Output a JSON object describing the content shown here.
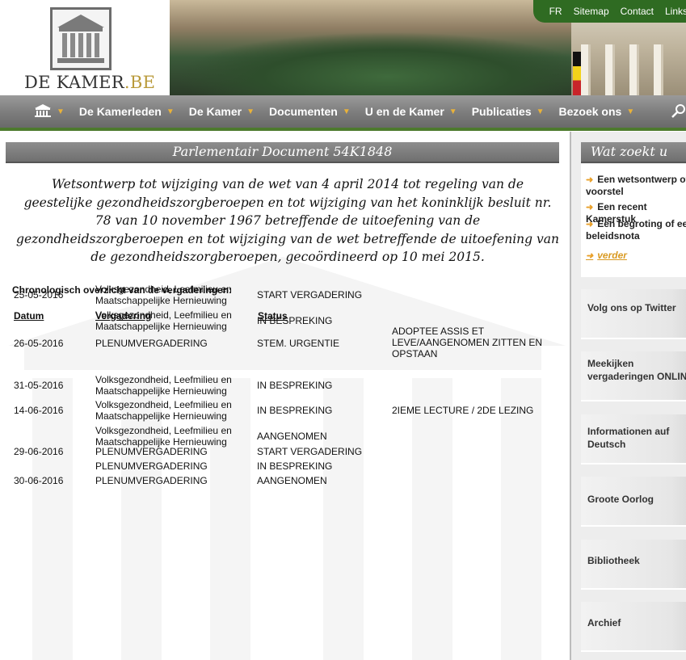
{
  "site": {
    "logo_text": "DE KAMER",
    "logo_suffix": ".BE"
  },
  "top_links": [
    "FR",
    "Sitemap",
    "Contact",
    "Links"
  ],
  "nav": {
    "items": [
      "De Kamerleden",
      "De Kamer",
      "Documenten",
      "U en de Kamer",
      "Publicaties",
      "Bezoek ons"
    ]
  },
  "document": {
    "title": "Parlementair Document 54K1848",
    "subject": "Wetsontwerp tot wijziging van de wet van 4 april 2014 tot regeling van de geestelijke gezondheidszorgberoepen en tot wijziging van het koninklijk besluit nr. 78 van 10 november 1967 betreffende de uitoefening van de gezondheidszorgberoepen en tot wijziging van de wet betreffende de uitoefening van de gezondheidszorgberoepen, gecoördineerd op 10 mei 2015.",
    "overview_heading": "Chronologisch overzicht van de vergaderingen:"
  },
  "meetings": {
    "headers": {
      "date": "Datum",
      "meeting": "Vergadering",
      "status": "Status"
    },
    "rows": [
      {
        "date": "25-05-2016",
        "meeting": "Volksgezondheid, Leefmilieu en Maatschappelijke Hernieuwing",
        "status": "START VERGADERING",
        "note": ""
      },
      {
        "date": "",
        "meeting": "Volksgezondheid, Leefmilieu en Maatschappelijke Hernieuwing",
        "status": "IN BESPREKING",
        "note": ""
      },
      {
        "date": "26-05-2016",
        "meeting": "PLENUMVERGADERING",
        "status": "STEM. URGENTIE",
        "note": "ADOPTEE ASSIS ET LEVE/AANGENOMEN ZITTEN EN OPSTAAN"
      },
      {
        "date": "31-05-2016",
        "meeting": "Volksgezondheid, Leefmilieu en Maatschappelijke Hernieuwing",
        "status": "IN BESPREKING",
        "note": ""
      },
      {
        "date": "14-06-2016",
        "meeting": "Volksgezondheid, Leefmilieu en Maatschappelijke Hernieuwing",
        "status": "IN BESPREKING",
        "note": "2IEME LECTURE / 2DE LEZING"
      },
      {
        "date": "",
        "meeting": "Volksgezondheid, Leefmilieu en Maatschappelijke Hernieuwing",
        "status": "AANGENOMEN",
        "note": ""
      },
      {
        "date": "29-06-2016",
        "meeting": "PLENUMVERGADERING",
        "status": "START VERGADERING",
        "note": ""
      },
      {
        "date": "",
        "meeting": "PLENUMVERGADERING",
        "status": "IN BESPREKING",
        "note": ""
      },
      {
        "date": "30-06-2016",
        "meeting": "PLENUMVERGADERING",
        "status": "AANGENOMEN",
        "note": ""
      }
    ]
  },
  "sidebar": {
    "search_title": "Wat zoekt u",
    "search_links": [
      "Een wetsontwerp of voorstel",
      "Een recent Kamerstuk",
      "Een begroting of een beleidsnota"
    ],
    "more_link": "verder",
    "blocks": [
      "Volg ons op Twitter",
      "Meekijken vergaderingen ONLINE",
      "Informationen auf Deutsch",
      "Groote Oorlog",
      "Bibliotheek",
      "Archief"
    ]
  },
  "colors": {
    "nav_accent": "#4d7a2d",
    "caret": "#e9b23a",
    "top_bar": "#2f6b22",
    "logo_suffix": "#b99a3a"
  }
}
